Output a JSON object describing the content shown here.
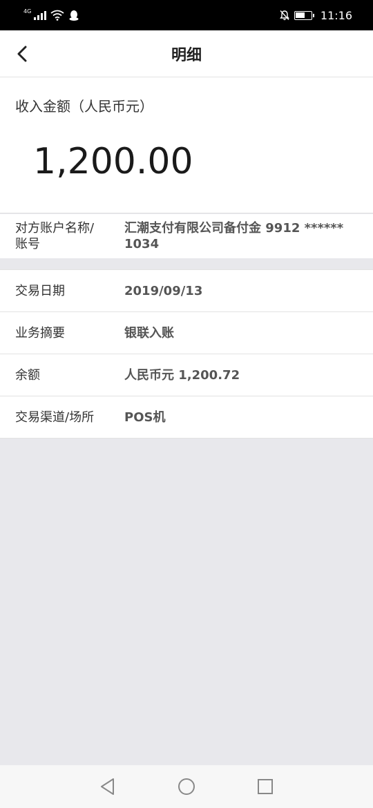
{
  "status_bar": {
    "network": "4G",
    "time": "11:16"
  },
  "nav": {
    "title": "明细"
  },
  "amount": {
    "label": "收入金额（人民币元）",
    "value": "1,200.00"
  },
  "account": {
    "label_line1": "对方账户名称/",
    "label_line2": "账号",
    "value_line1": "汇潮支付有限公司备付金 9912 ******",
    "value_line2": "1034"
  },
  "details": [
    {
      "label": "交易日期",
      "value": "2019/09/13"
    },
    {
      "label": "业务摘要",
      "value": "银联入账"
    },
    {
      "label": "余额",
      "value": "人民币元 1,200.72"
    },
    {
      "label": "交易渠道/场所",
      "value": "POS机"
    }
  ],
  "colors": {
    "background": "#e8e8ec",
    "card": "#ffffff",
    "divider": "#e2e2e2"
  }
}
